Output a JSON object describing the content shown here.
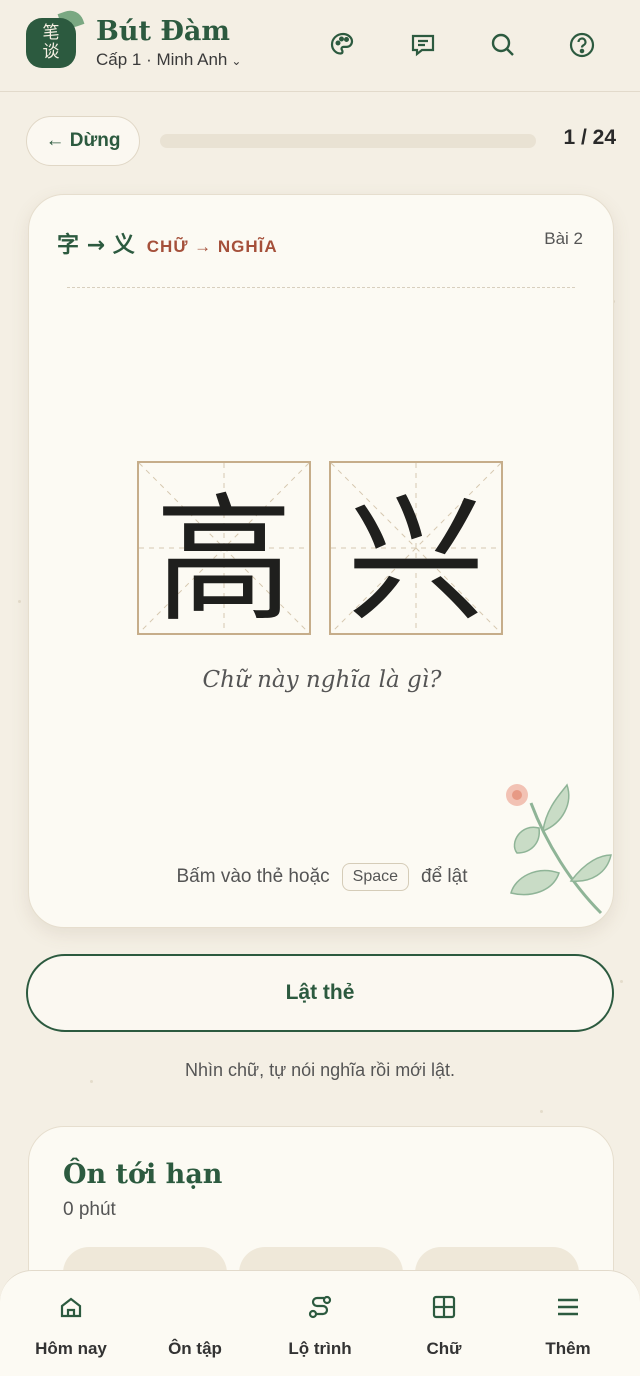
{
  "header": {
    "logo_chars": [
      "笔",
      "谈"
    ],
    "app_name": "Bút Đàm",
    "profile_label": "Cấp 1 · Minh Anh",
    "icons": [
      "palette-icon",
      "chat-icon",
      "search-icon",
      "help-icon"
    ]
  },
  "session": {
    "stop_label": "← Dừng",
    "progress_text": "1 / 24",
    "progress_fraction": 0.0
  },
  "card": {
    "mode_hanzi": "字 → 义",
    "mode_label": "CHỮ → NGHĨA",
    "lesson": "Bài 2",
    "characters": [
      "高",
      "兴"
    ],
    "question": "Chữ này nghĩa là gì?",
    "hint_before": "Bấm vào thẻ hoặc",
    "hint_key": "Space",
    "hint_after": "để lật"
  },
  "actions": {
    "flip_label": "Lật thẻ",
    "tip": "Nhìn chữ, tự nói nghĩa rồi mới lật."
  },
  "upcoming": {
    "title": "Ôn tới hạn",
    "subtitle": "0 phút"
  },
  "nav": {
    "items": [
      {
        "label": "Hôm nay",
        "icon": "home-icon",
        "active": false
      },
      {
        "label": "Ôn tập",
        "icon": "cards-icon",
        "active": true
      },
      {
        "label": "Lộ trình",
        "icon": "route-icon",
        "active": false
      },
      {
        "label": "Chữ",
        "icon": "character-grid-icon",
        "active": false
      },
      {
        "label": "Thêm",
        "icon": "menu-icon",
        "active": false
      }
    ]
  },
  "colors": {
    "accent": "#2c5a3f",
    "mode_label": "#a5503a",
    "background": "#f4efe4",
    "card": "#fcfaf3",
    "grid_border": "#c6ad8a"
  }
}
